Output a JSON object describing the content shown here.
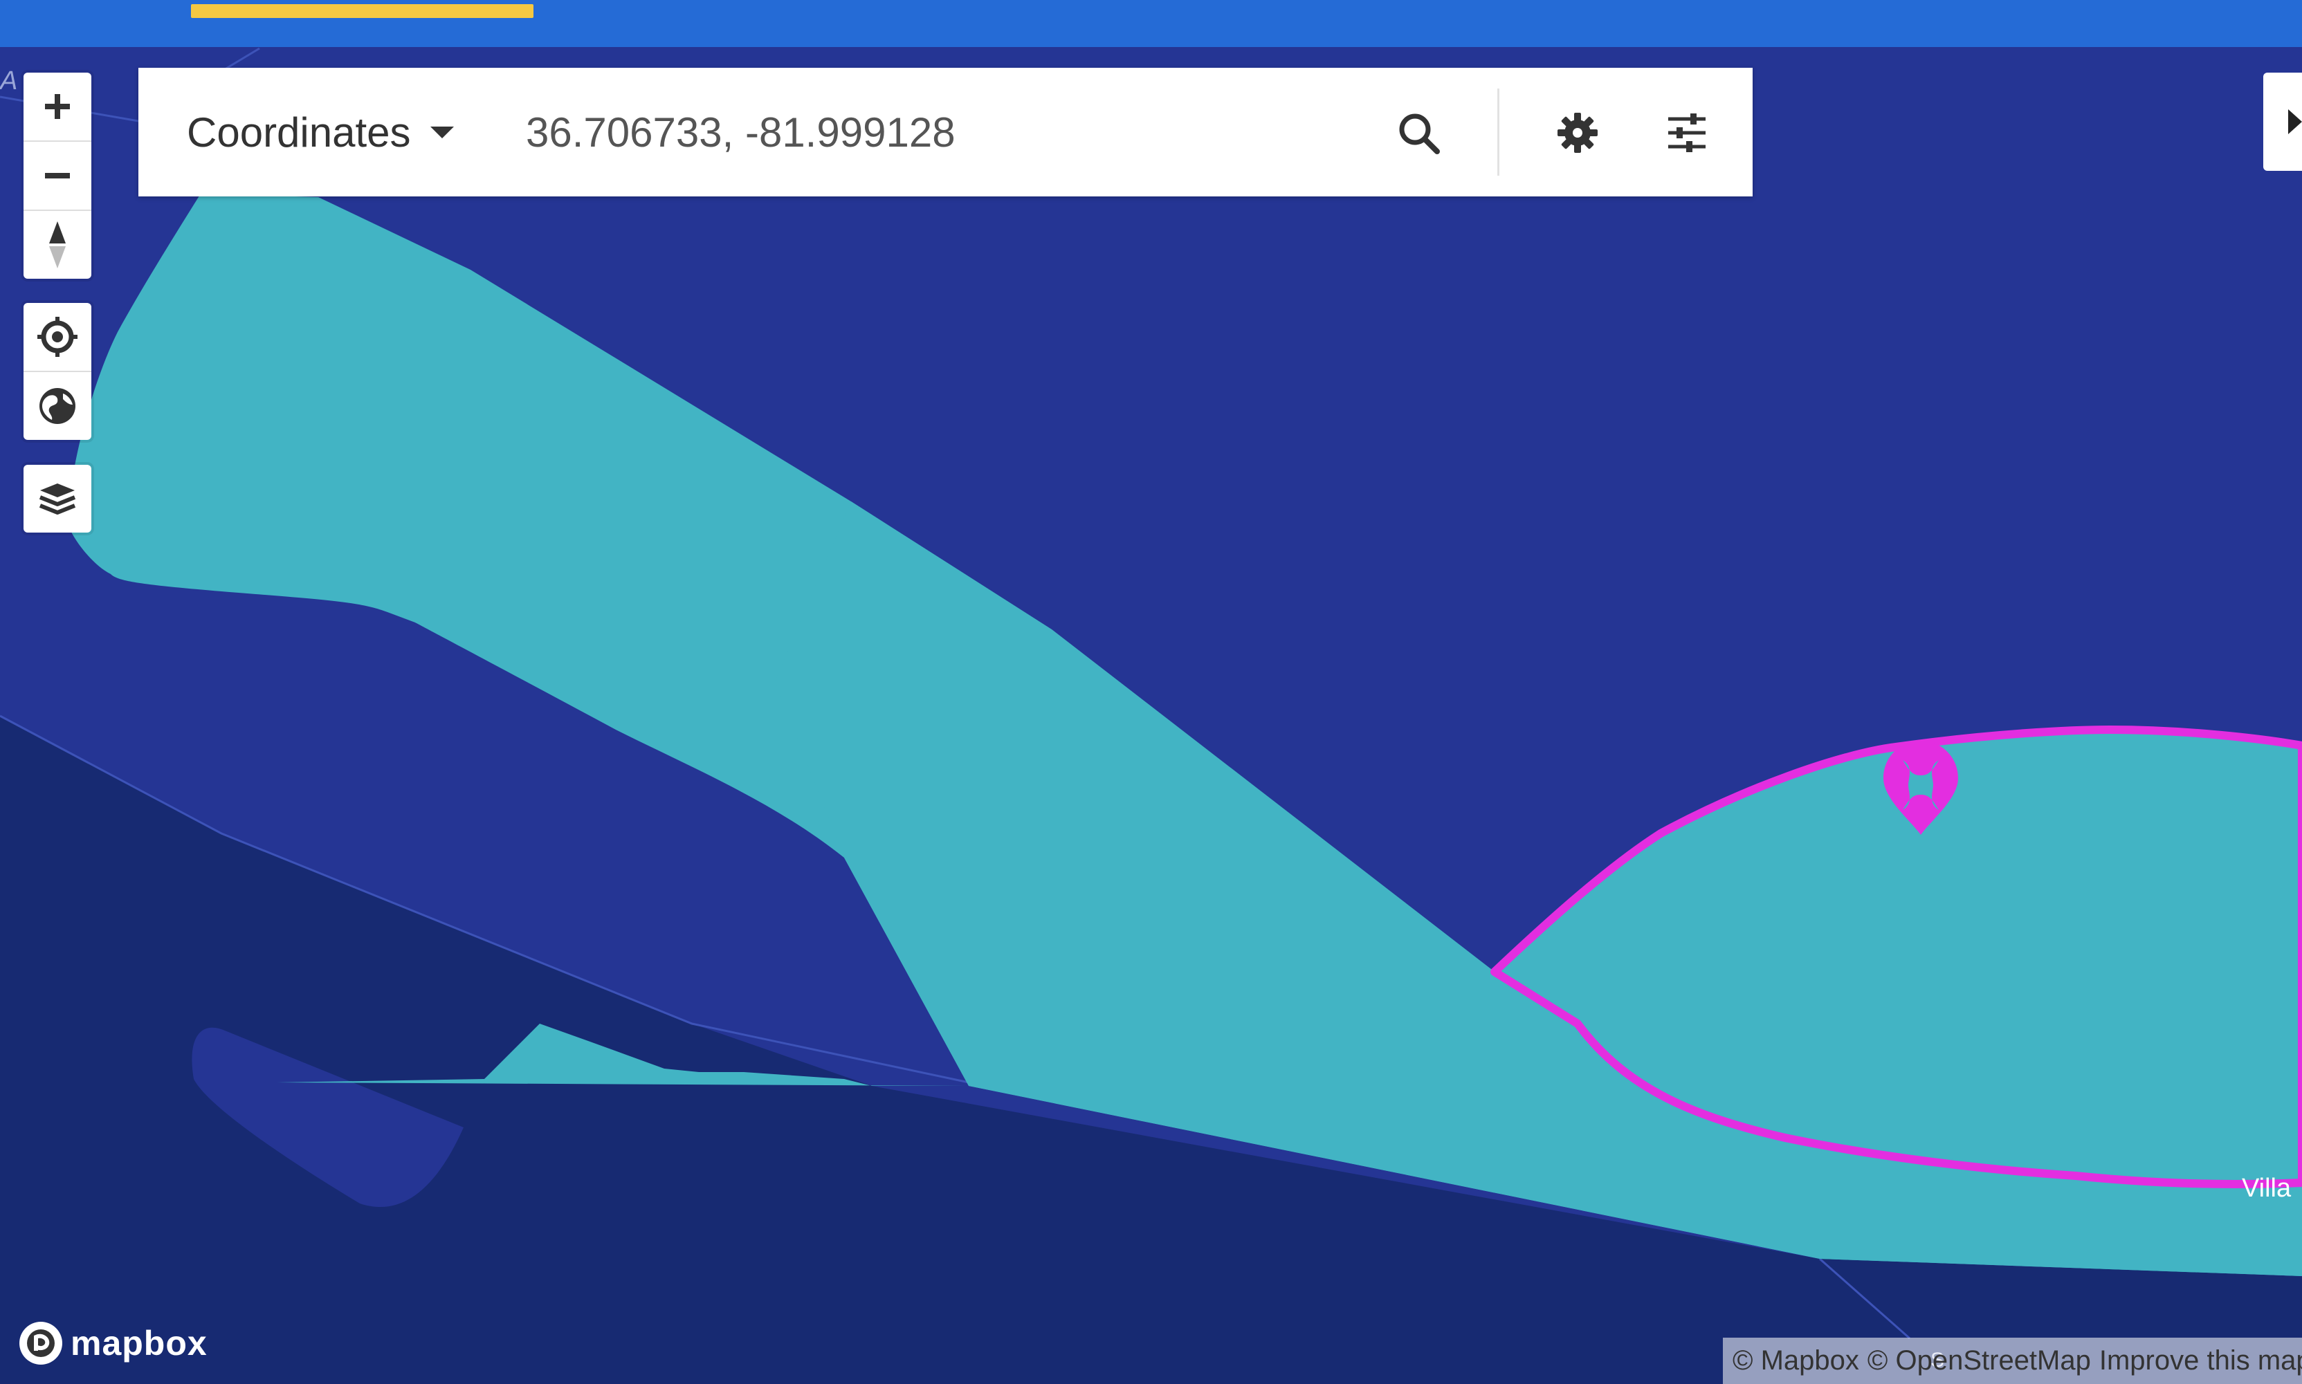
{
  "search": {
    "mode_label": "Coordinates",
    "query_value": "36.706733, -81.999128",
    "placeholder": ""
  },
  "icons": {
    "zoom_in": "plus-icon",
    "zoom_out": "minus-icon",
    "compass": "compass-icon",
    "locate": "crosshair-icon",
    "globe": "globe-icon",
    "layers": "layers-icon",
    "search": "search-icon",
    "settings": "gear-icon",
    "filters": "sliders-icon",
    "panel_toggle": "caret-right-icon",
    "marker": "map-pin-icon"
  },
  "map": {
    "labels": {
      "right_edge": "Villa",
      "top_left_fragment": "A",
      "bottom_road": "S"
    },
    "colors": {
      "background_dark": "#172a72",
      "land_mid": "#253594",
      "highlight_region": "#42b4c4",
      "selection_outline": "#e32ee0",
      "marker": "#e32ee0",
      "topbar": "#256bd6",
      "topbar_progress": "#f5c842"
    }
  },
  "footer": {
    "logo_text": "mapbox",
    "attribution": {
      "mapbox": "© Mapbox",
      "osm": "© OpenStreetMap",
      "improve": "Improve this map"
    }
  }
}
